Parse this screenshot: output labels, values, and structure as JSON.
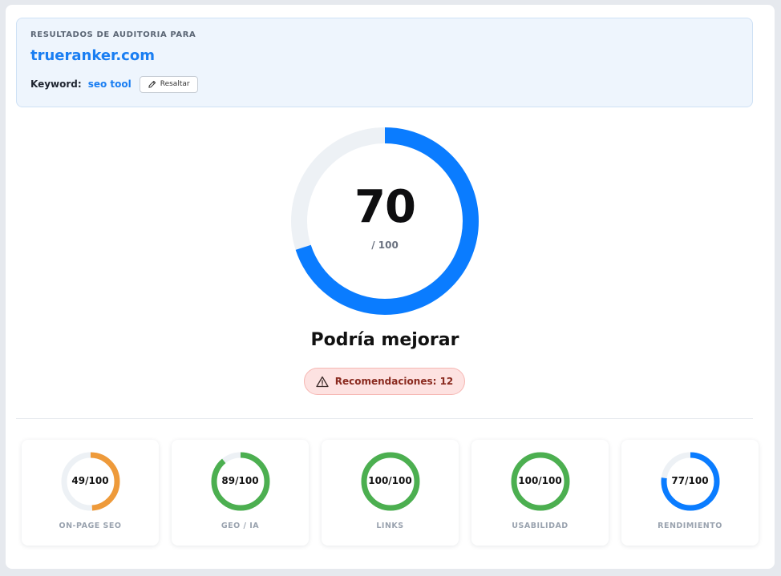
{
  "header": {
    "label": "RESULTADOS DE AUDITORIA PARA",
    "domain": "trueranker.com",
    "keyword_label": "Keyword:",
    "keyword_value": "seo tool",
    "highlight_button": "Resaltar"
  },
  "overall": {
    "score": "70",
    "score_value": 70,
    "max": "/ 100",
    "verdict": "Podría mejorar",
    "recommendations": "Recomendaciones: 12",
    "color": "#0a7cff",
    "track_color": "#edf1f5"
  },
  "categories": [
    {
      "score": "49/100",
      "value": 49,
      "label": "ON-PAGE SEO",
      "color": "#ee9a3a"
    },
    {
      "score": "89/100",
      "value": 89,
      "label": "GEO / IA",
      "color": "#4caf50"
    },
    {
      "score": "100/100",
      "value": 100,
      "label": "LINKS",
      "color": "#4caf50"
    },
    {
      "score": "100/100",
      "value": 100,
      "label": "USABILIDAD",
      "color": "#4caf50"
    },
    {
      "score": "77/100",
      "value": 77,
      "label": "RENDIMIENTO",
      "color": "#0a7cff"
    }
  ]
}
